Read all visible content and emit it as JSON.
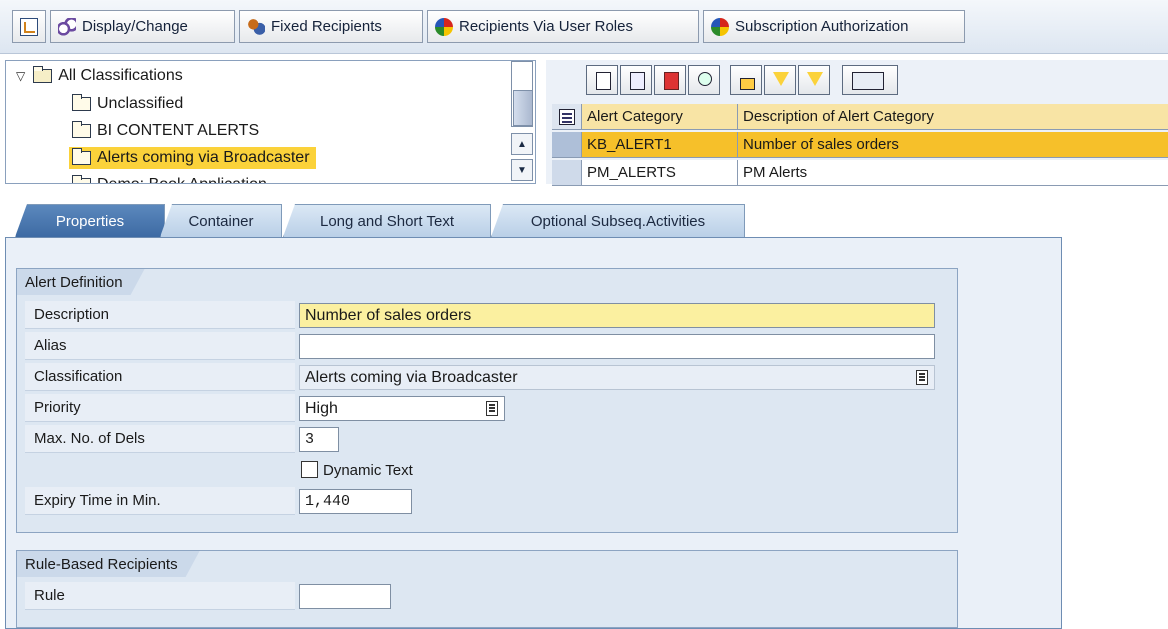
{
  "toolbar": {
    "buttons": [
      {
        "icon": "tree-toggle-icon",
        "label": ""
      },
      {
        "icon": "glasses-icon",
        "label": "Display/Change"
      },
      {
        "icon": "persons-icon",
        "label": "Fixed Recipients"
      },
      {
        "icon": "ball-icon",
        "label": "Recipients Via User Roles"
      },
      {
        "icon": "ball-icon",
        "label": "Subscription Authorization"
      }
    ]
  },
  "tree": {
    "root": "All Classifications",
    "items": [
      "Unclassified",
      "BI CONTENT ALERTS",
      "Alerts coming via Broadcaster",
      "Demo: Book Application"
    ],
    "selected": "Alerts coming via Broadcaster"
  },
  "grid": {
    "columns": [
      "Alert Category",
      "Description of Alert Category"
    ],
    "rows": [
      {
        "category": "KB_ALERT1",
        "description": "Number of sales orders",
        "selected": true
      },
      {
        "category": "PM_ALERTS",
        "description": "PM Alerts",
        "selected": false
      }
    ]
  },
  "tabs": [
    {
      "label": "Properties",
      "active": true
    },
    {
      "label": "Container",
      "active": false
    },
    {
      "label": "Long and Short Text",
      "active": false
    },
    {
      "label": "Optional Subseq.Activities",
      "active": false
    }
  ],
  "alert_definition": {
    "title": "Alert Definition",
    "description_label": "Description",
    "description_value": "Number of sales orders",
    "alias_label": "Alias",
    "alias_value": "",
    "classification_label": "Classification",
    "classification_value": "Alerts coming via Broadcaster",
    "priority_label": "Priority",
    "priority_value": "High",
    "max_dels_label": "Max. No. of Dels",
    "max_dels_value": "3",
    "dynamic_text_label": "Dynamic Text",
    "dynamic_text_checked": false,
    "expiry_label": "Expiry Time in Min.",
    "expiry_value": "1,440"
  },
  "rule_based": {
    "title": "Rule-Based Recipients",
    "rule_label": "Rule",
    "rule_value": ""
  },
  "colors": {
    "selection": "#F6C02A",
    "active_tab": "#3D6AA3",
    "highlight_field": "#FBF0A0"
  }
}
